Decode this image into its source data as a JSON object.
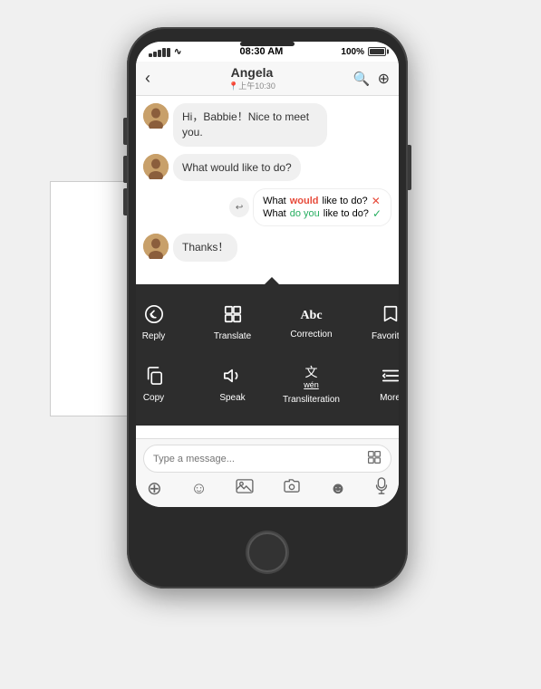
{
  "scene": {
    "background": "#f0f0f0"
  },
  "statusBar": {
    "signal": "●●●●●",
    "wifi": "WiFi",
    "time": "08:30 AM",
    "battery": "100%"
  },
  "navBar": {
    "back": "‹",
    "title": "Angela",
    "subtitle": "📍上午10:30",
    "searchIcon": "🔍",
    "settingsIcon": "⊕"
  },
  "messages": [
    {
      "id": 1,
      "side": "left",
      "text": "Hi，Babbie！Nice to meet you.",
      "hasAvatar": true
    },
    {
      "id": 2,
      "side": "left",
      "text": "What would like to do?",
      "hasAvatar": true
    },
    {
      "id": 3,
      "side": "right",
      "type": "correction",
      "wrong": "What would like to do?",
      "correct": "What do you like to do?"
    },
    {
      "id": 4,
      "side": "left",
      "text": "Thanks！",
      "hasAvatar": true
    }
  ],
  "contextMenu": {
    "items": [
      {
        "id": "reply",
        "icon": "💬",
        "label": "Reply"
      },
      {
        "id": "translate",
        "icon": "译",
        "label": "Translate"
      },
      {
        "id": "correction",
        "icon": "Abc",
        "label": "Correction"
      },
      {
        "id": "favorites",
        "icon": "🔖",
        "label": "Favorites"
      },
      {
        "id": "copy",
        "icon": "⧉",
        "label": "Copy"
      },
      {
        "id": "speak",
        "icon": "🔈",
        "label": "Speak"
      },
      {
        "id": "transliteration",
        "icon": "文\nwén",
        "label": "Transliteration"
      },
      {
        "id": "more",
        "icon": "≡",
        "label": "More"
      }
    ]
  },
  "inputBar": {
    "placeholder": "Type a message...",
    "translateIconLabel": "Translate"
  },
  "bottomIcons": [
    {
      "id": "plus",
      "label": "add",
      "icon": "+"
    },
    {
      "id": "emoji",
      "label": "emoji",
      "icon": "☺"
    },
    {
      "id": "image",
      "label": "image",
      "icon": "🖼"
    },
    {
      "id": "camera",
      "label": "camera",
      "icon": "⊡"
    },
    {
      "id": "sticker",
      "label": "sticker",
      "icon": "☻"
    },
    {
      "id": "mic",
      "label": "mic",
      "icon": "🎤"
    }
  ]
}
